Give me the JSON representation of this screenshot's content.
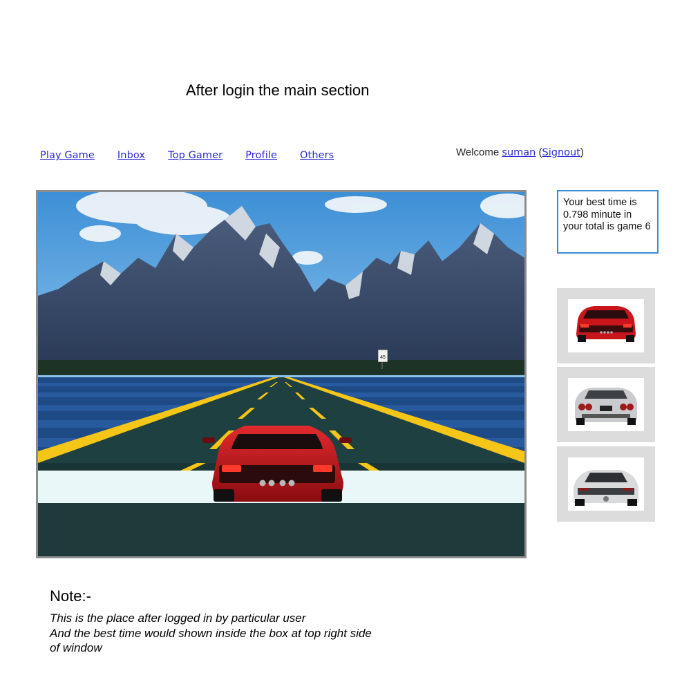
{
  "page": {
    "title": "After login the main section"
  },
  "nav": {
    "items": [
      "Play Game",
      "Inbox",
      "Top Gamer",
      "Profile",
      "Others"
    ]
  },
  "user": {
    "welcome_prefix": "Welcome ",
    "username": "suman",
    "open_paren": " (",
    "signout_label": "Signout",
    "close_paren": ")"
  },
  "best_time": {
    "text": "Your best time is 0.798 minute in your total is game 6"
  },
  "game": {
    "speed_sign": "45"
  },
  "cars": [
    {
      "name": "red-sports-car",
      "color": "#c8161c"
    },
    {
      "name": "silver-sports-car",
      "color": "#c9cbce"
    },
    {
      "name": "white-sports-car",
      "color": "#d9dadc"
    }
  ],
  "note": {
    "title": "Note:-",
    "lines": [
      "This is the place after logged in by particular user",
      "And the best time would shown inside the box at top right side",
      "of window"
    ]
  }
}
